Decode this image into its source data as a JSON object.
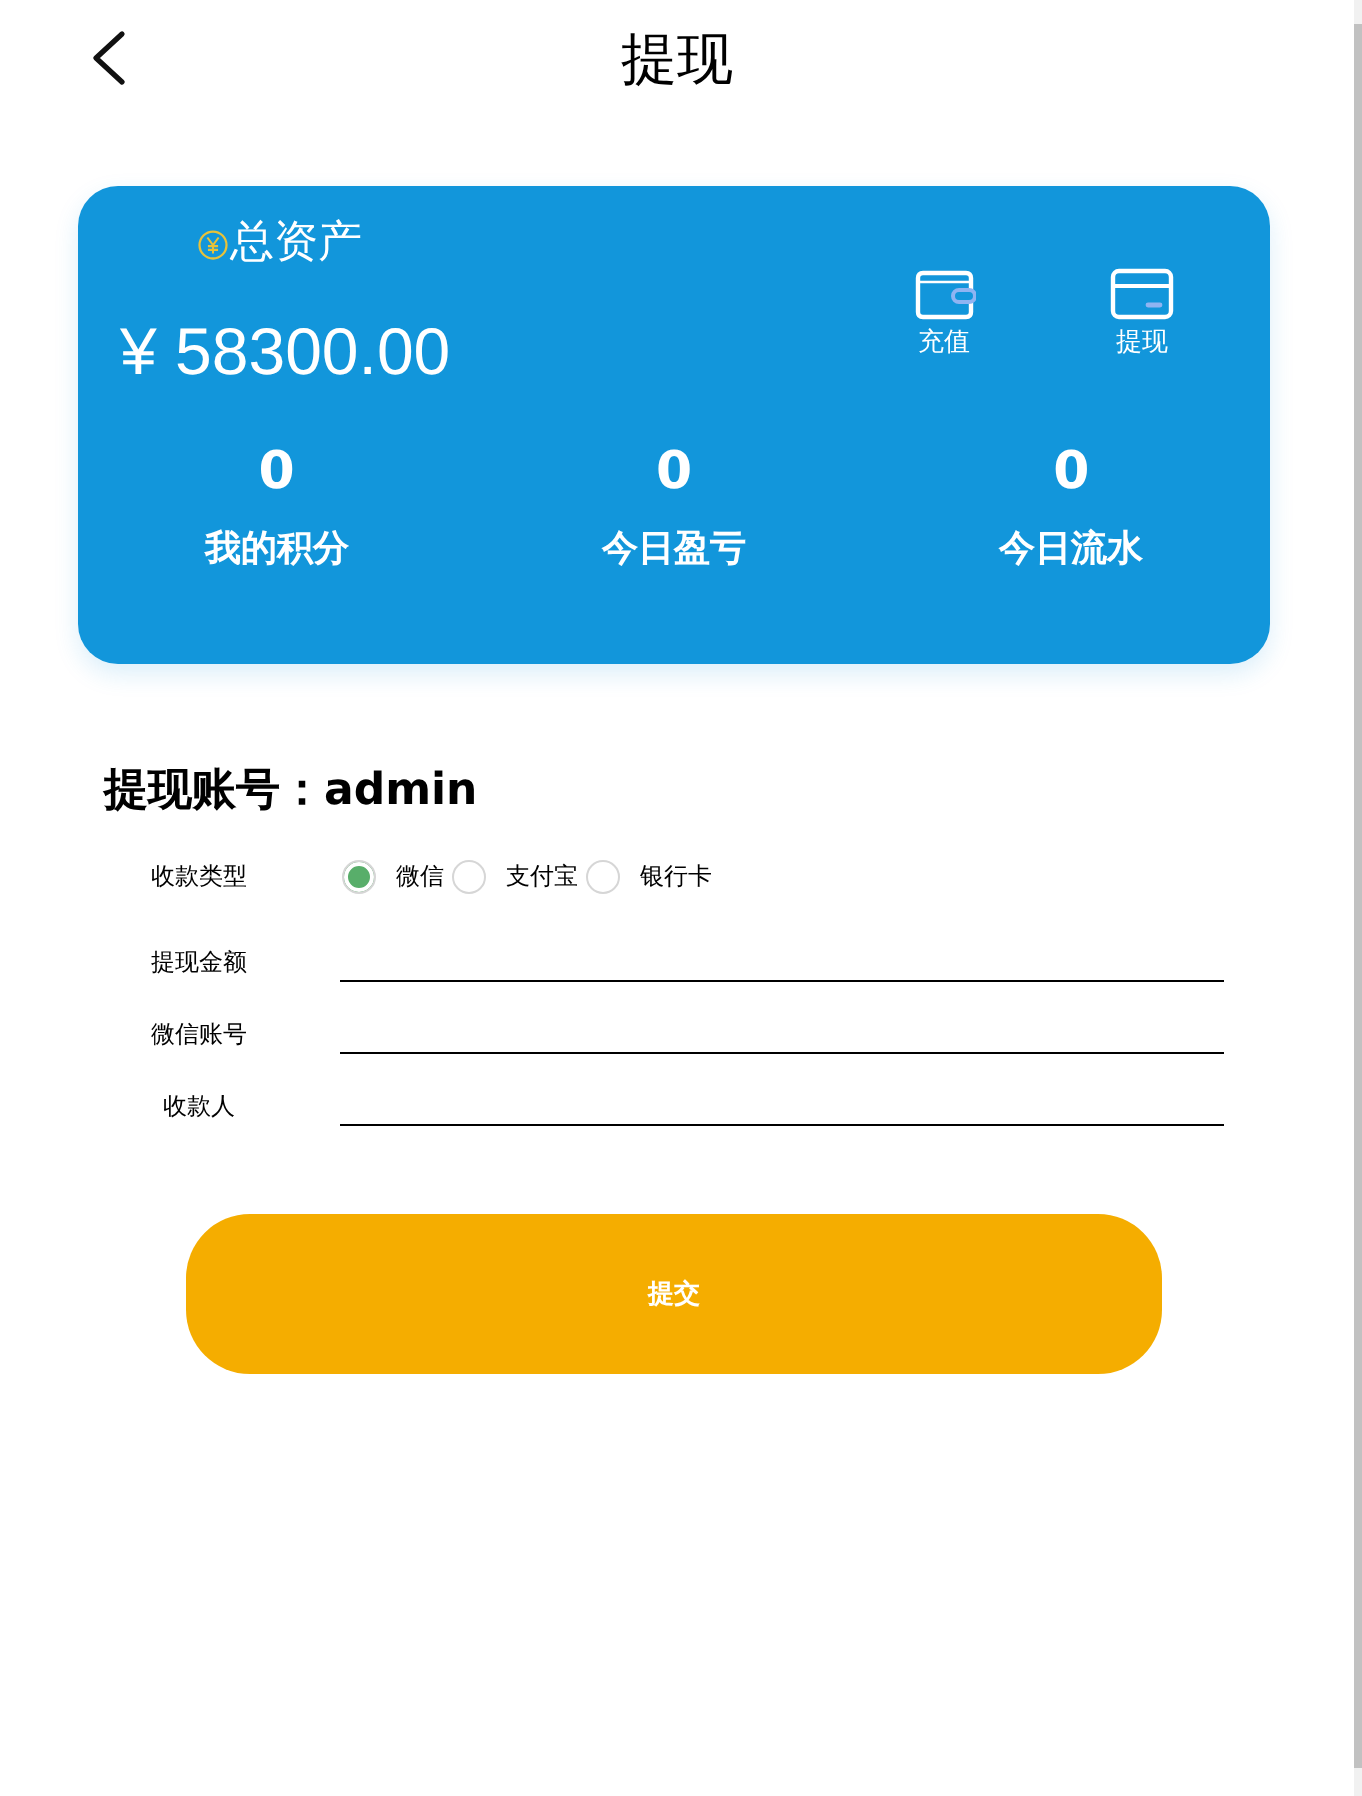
{
  "header": {
    "title": "提现"
  },
  "asset_card": {
    "title": "总资产",
    "amount": "¥ 58300.00",
    "actions": [
      {
        "kind": "wallet",
        "label": "充值"
      },
      {
        "kind": "card",
        "label": "提现"
      }
    ],
    "stats": [
      {
        "value": "0",
        "label": "我的积分"
      },
      {
        "value": "0",
        "label": "今日盈亏"
      },
      {
        "value": "0",
        "label": "今日流水"
      }
    ]
  },
  "form": {
    "account_title": "提现账号：admin",
    "payment_type": {
      "label": "收款类型",
      "options": [
        {
          "label": "微信",
          "selected": true
        },
        {
          "label": "支付宝",
          "selected": false
        },
        {
          "label": "银行卡",
          "selected": false
        }
      ]
    },
    "fields": [
      {
        "label": "提现金额"
      },
      {
        "label": "微信账号"
      },
      {
        "label": "收款人"
      }
    ],
    "submit": "提交"
  }
}
